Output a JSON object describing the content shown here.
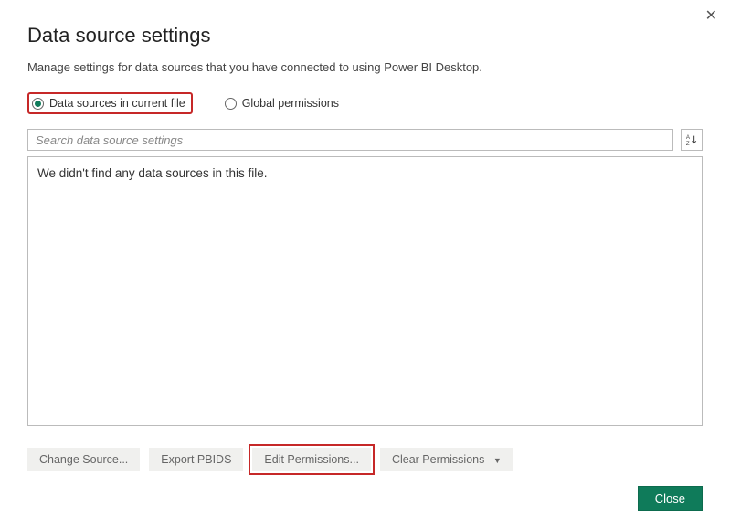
{
  "dialog": {
    "title": "Data source settings",
    "subtitle": "Manage settings for data sources that you have connected to using Power BI Desktop.",
    "close_symbol": "✕"
  },
  "scope": {
    "current_file_label": "Data sources in current file",
    "global_label": "Global permissions",
    "selected": "current_file"
  },
  "search": {
    "placeholder": "Search data source settings"
  },
  "results": {
    "empty_message": "We didn't find any data sources in this file."
  },
  "actions": {
    "change_source": "Change Source...",
    "export_pbids": "Export PBIDS",
    "edit_permissions": "Edit Permissions...",
    "clear_permissions": "Clear Permissions"
  },
  "footer": {
    "close": "Close"
  }
}
